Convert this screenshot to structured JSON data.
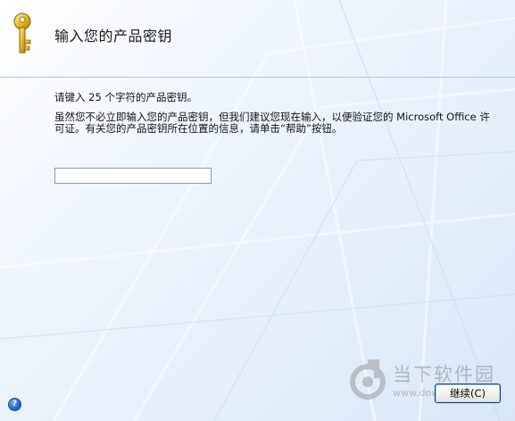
{
  "header": {
    "title": "输入您的产品密钥",
    "icon": "key-icon"
  },
  "main": {
    "instruction": "请键入 25 个字符的产品密钥。",
    "explanation": "虽然您不必立即输入您的产品密钥，但我们建议您现在输入，以便验证您的 Microsoft Office 许可证。有关您的产品密钥所在位置的信息，请单击“帮助”按钮。",
    "product_key_value": ""
  },
  "footer": {
    "help_icon": "help-icon",
    "help_glyph": "?",
    "continue_label": "继续(C)"
  },
  "watermark": {
    "name": "当下软件园",
    "url": "www.downxia.com"
  },
  "colors": {
    "background_light": "#ffffff",
    "background_blue": "#d8e7f8",
    "divider": "#a9c4e4",
    "key_gold": "#e8b923",
    "help_blue": "#2a64c8"
  }
}
